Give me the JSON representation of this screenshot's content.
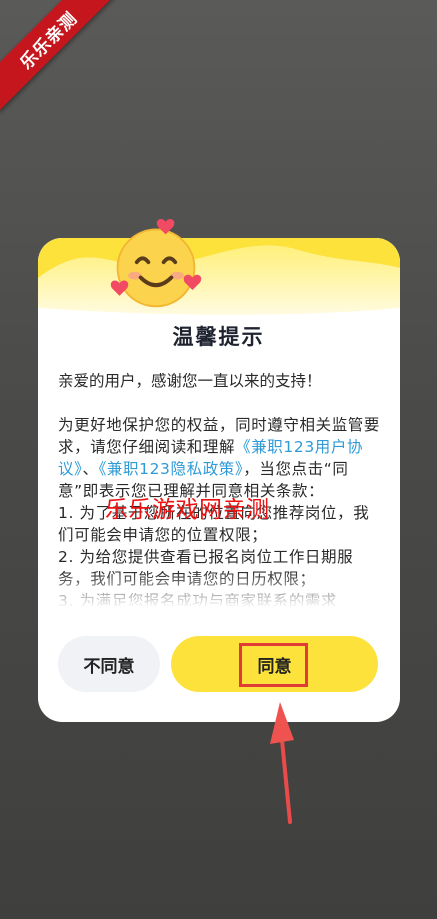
{
  "corner_banner": {
    "text": "乐乐亲测"
  },
  "dialog": {
    "title": "温馨提示",
    "greeting": "亲爱的用户，感谢您一直以来的支持！",
    "body_segments": {
      "p1": "为更好地保护您的权益，同时遵守相关监管要求，请您仔细阅读和理解",
      "link_user_agreement": "《兼职123用户协议》",
      "sep": "、",
      "link_privacy_policy": "《兼职123隐私政策》",
      "p2": "，当您点击“同意”即表示您已理解并同意相关条款：",
      "item1": "1. 为了基于您所在的位置向您推荐岗位，我们可能会申请您的位置权限；",
      "item2": "2. 为给您提供查看已报名岗位工作日期服务，我们可能会申请您的日历权限；",
      "item3": "3. 为满足您报名成功与商家联系的需求"
    },
    "buttons": {
      "disagree": "不同意",
      "agree": "同意"
    }
  },
  "watermark": {
    "text": "乐乐游戏网亲测"
  },
  "colors": {
    "accent_yellow": "#fde23b",
    "link_blue": "#2f9bd6",
    "highlight_red": "#e23a36",
    "banner_red": "#c4161c"
  },
  "icons": [
    "smiling-face-with-hearts-icon",
    "red-arrow-icon"
  ]
}
